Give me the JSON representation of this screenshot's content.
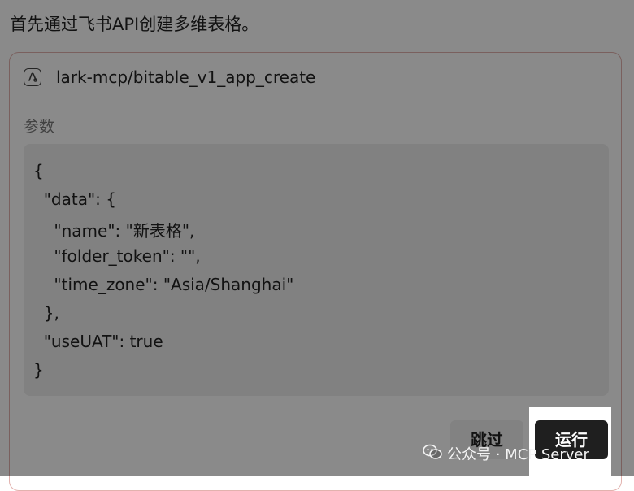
{
  "intro_text": "首先通过飞书API创建多维表格。",
  "tool": {
    "icon": "tool-link-icon",
    "name": "lark-mcp/bitable_v1_app_create"
  },
  "params_label": "参数",
  "code_lines": [
    "{",
    "  \"data\": {",
    "    \"name\": \"新表格\",",
    "    \"folder_token\": \"\",",
    "    \"time_zone\": \"Asia/Shanghai\"",
    "  },",
    "  \"useUAT\": true",
    "}"
  ],
  "buttons": {
    "skip_label": "跳过",
    "run_label": "运行"
  },
  "watermark": {
    "icon": "wechat-icon",
    "text": "公众号 · MCP Server"
  },
  "colors": {
    "card_border": "#e2b2ae",
    "code_bg": "#efefef",
    "run_button_bg": "#1f1f1f",
    "overlay": "rgba(0,0,0,0.46)"
  }
}
